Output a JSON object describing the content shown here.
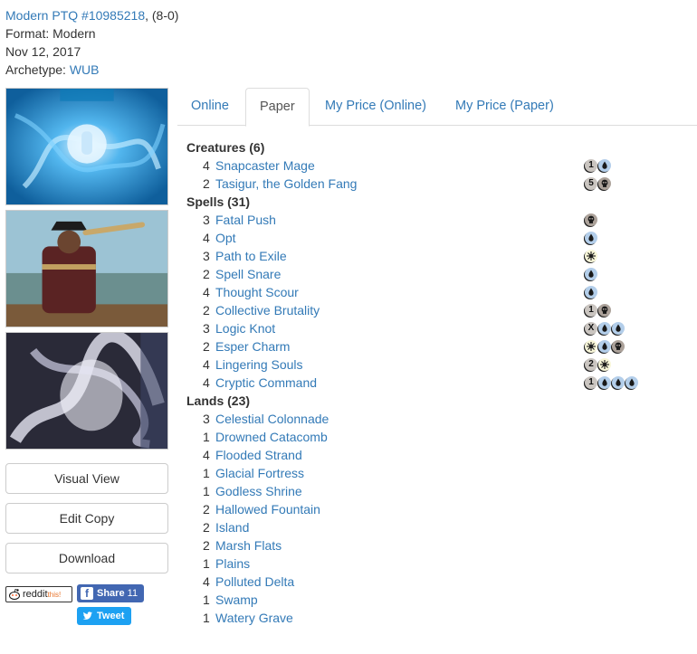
{
  "deck": {
    "event_link": "Modern PTQ #10985218",
    "record": ", (8-0)",
    "format_line": "Format: Modern",
    "date": "Nov 12, 2017",
    "archetype_label": "Archetype: ",
    "archetype": "WUB"
  },
  "buttons": {
    "visual_view": "Visual View",
    "edit_copy": "Edit Copy",
    "download": "Download"
  },
  "social": {
    "reddit_label": "reddit",
    "reddit_suffix": "this!",
    "facebook_label": "Share",
    "facebook_count": "11",
    "twitter_label": "Tweet"
  },
  "tabs": [
    "Online",
    "Paper",
    "My Price (Online)",
    "My Price (Paper)"
  ],
  "active_tab": "Paper",
  "sections": [
    {
      "title": "Creatures (6)",
      "cards": [
        {
          "qty": "4",
          "name": "Snapcaster Mage",
          "mana": [
            "1",
            "U"
          ]
        },
        {
          "qty": "2",
          "name": "Tasigur, the Golden Fang",
          "mana": [
            "5",
            "B"
          ]
        }
      ]
    },
    {
      "title": "Spells (31)",
      "cards": [
        {
          "qty": "3",
          "name": "Fatal Push",
          "mana": [
            "B"
          ]
        },
        {
          "qty": "4",
          "name": "Opt",
          "mana": [
            "U"
          ]
        },
        {
          "qty": "3",
          "name": "Path to Exile",
          "mana": [
            "W"
          ]
        },
        {
          "qty": "2",
          "name": "Spell Snare",
          "mana": [
            "U"
          ]
        },
        {
          "qty": "4",
          "name": "Thought Scour",
          "mana": [
            "U"
          ]
        },
        {
          "qty": "2",
          "name": "Collective Brutality",
          "mana": [
            "1",
            "B"
          ]
        },
        {
          "qty": "3",
          "name": "Logic Knot",
          "mana": [
            "X",
            "U",
            "U"
          ]
        },
        {
          "qty": "2",
          "name": "Esper Charm",
          "mana": [
            "W",
            "U",
            "B"
          ]
        },
        {
          "qty": "4",
          "name": "Lingering Souls",
          "mana": [
            "2",
            "W"
          ]
        },
        {
          "qty": "4",
          "name": "Cryptic Command",
          "mana": [
            "1",
            "U",
            "U",
            "U"
          ]
        }
      ]
    },
    {
      "title": "Lands (23)",
      "cards": [
        {
          "qty": "3",
          "name": "Celestial Colonnade",
          "mana": []
        },
        {
          "qty": "1",
          "name": "Drowned Catacomb",
          "mana": []
        },
        {
          "qty": "4",
          "name": "Flooded Strand",
          "mana": []
        },
        {
          "qty": "1",
          "name": "Glacial Fortress",
          "mana": []
        },
        {
          "qty": "1",
          "name": "Godless Shrine",
          "mana": []
        },
        {
          "qty": "2",
          "name": "Hallowed Fountain",
          "mana": []
        },
        {
          "qty": "2",
          "name": "Island",
          "mana": []
        },
        {
          "qty": "2",
          "name": "Marsh Flats",
          "mana": []
        },
        {
          "qty": "1",
          "name": "Plains",
          "mana": []
        },
        {
          "qty": "4",
          "name": "Polluted Delta",
          "mana": []
        },
        {
          "qty": "1",
          "name": "Swamp",
          "mana": []
        },
        {
          "qty": "1",
          "name": "Watery Grave",
          "mana": []
        }
      ]
    }
  ],
  "colors": {
    "link": "#337ab7",
    "blue_mana": "#b3ceea",
    "black_mana": "#aca29a",
    "white_mana": "#f8f6d8",
    "generic_mana": "#cac5c0"
  }
}
